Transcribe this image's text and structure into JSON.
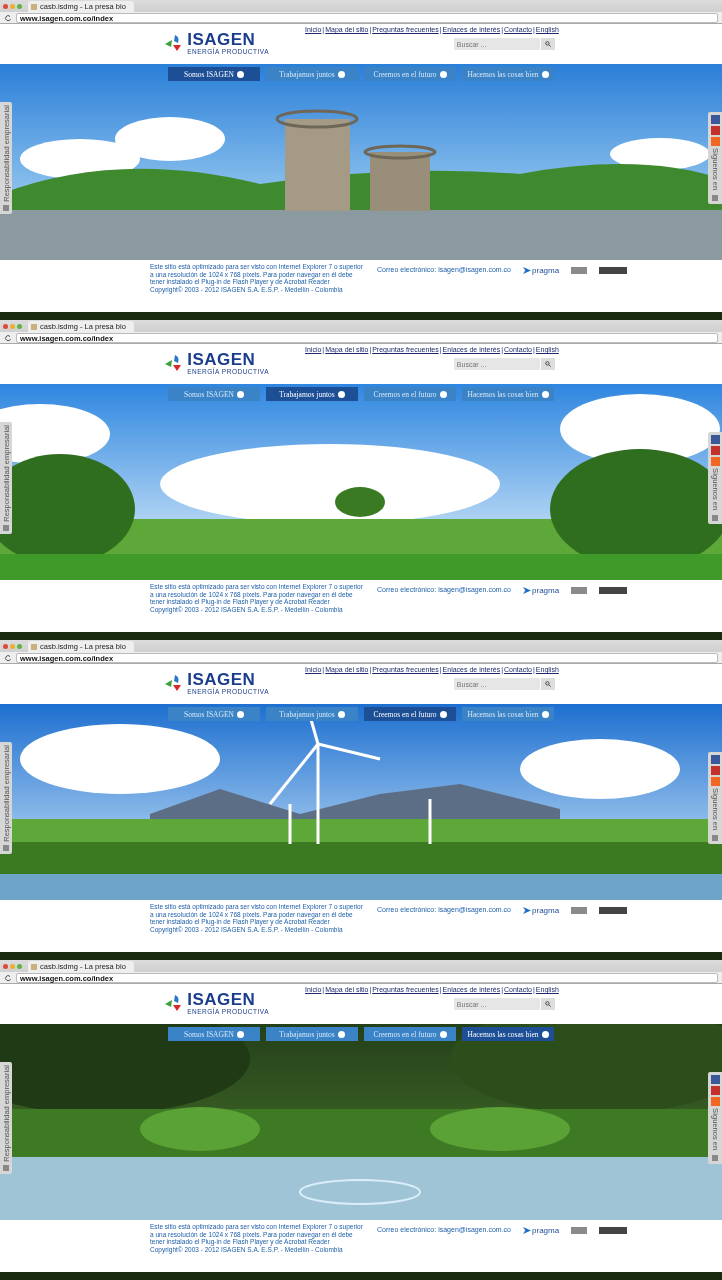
{
  "screens": [
    {
      "kind": "dam",
      "tab_title": "casb.isdmg - La presa bio",
      "url": "www.isagen.com.co/index",
      "logo": {
        "name": "ISAGEN",
        "tagline": "ENERGÍA PRODUCTIVA"
      },
      "top_links": [
        {
          "kind": "link",
          "text": "Inicio"
        },
        {
          "kind": "separator",
          "text": "|"
        },
        {
          "kind": "link",
          "text": "Mapa del sitio"
        },
        {
          "kind": "separator",
          "text": "|"
        },
        {
          "kind": "link",
          "text": "Preguntas frecuentes"
        },
        {
          "kind": "separator",
          "text": "|"
        },
        {
          "kind": "link",
          "text": "Enlaces de interés"
        },
        {
          "kind": "separator",
          "text": "|"
        },
        {
          "kind": "link",
          "text": "Contacto"
        },
        {
          "kind": "separator",
          "text": "|"
        },
        {
          "kind": "link",
          "text": "English"
        }
      ],
      "search": {
        "placeholder": "Buscar ..."
      },
      "nav": [
        {
          "label": "Somos ISAGEN",
          "selected": true
        },
        {
          "label": "Trabajamos juntos",
          "selected": false
        },
        {
          "label": "Creemos en el futuro",
          "selected": false
        },
        {
          "label": "Hacemos las cosas bien",
          "selected": false
        }
      ],
      "side_tab": "Responsabilidad empresarial",
      "follow_tab": "Síguenos en",
      "footer": {
        "notice": "Este sitio está optimizado para ser visto con Internet Explorer 7 o superior a una resolución de 1024 x 768 píxels. Para poder navegar en él debe tener instalado el Plug-in de Flash Player y de Acrobat Reader",
        "copyright": "Copyright© 2003 - 2012 ISAGEN S.A. E.S.P. - Medellín - Colombia",
        "email_label": "Correo electrónico:",
        "email": "isagen@isagen.com.co",
        "partner": "pragma"
      }
    },
    {
      "kind": "meadow",
      "tab_title": "casb.isdmg - La presa bio",
      "url": "www.isagen.com.co/index",
      "logo": {
        "name": "ISAGEN",
        "tagline": "ENERGÍA PRODUCTIVA"
      },
      "top_links": [
        {
          "kind": "link",
          "text": "Inicio"
        },
        {
          "kind": "separator",
          "text": "|"
        },
        {
          "kind": "link",
          "text": "Mapa del sitio"
        },
        {
          "kind": "separator",
          "text": "|"
        },
        {
          "kind": "link",
          "text": "Preguntas frecuentes"
        },
        {
          "kind": "separator",
          "text": "|"
        },
        {
          "kind": "link",
          "text": "Enlaces de interés"
        },
        {
          "kind": "separator",
          "text": "|"
        },
        {
          "kind": "link",
          "text": "Contacto"
        },
        {
          "kind": "separator",
          "text": "|"
        },
        {
          "kind": "link",
          "text": "English"
        }
      ],
      "search": {
        "placeholder": "Buscar ..."
      },
      "nav": [
        {
          "label": "Somos ISAGEN",
          "selected": false
        },
        {
          "label": "Trabajamos juntos",
          "selected": true
        },
        {
          "label": "Creemos en el futuro",
          "selected": false
        },
        {
          "label": "Hacemos las cosas bien",
          "selected": false
        }
      ],
      "side_tab": "Responsabilidad empresarial",
      "follow_tab": "Síguenos en",
      "footer": {
        "notice": "Este sitio está optimizado para ser visto con Internet Explorer 7 o superior a una resolución de 1024 x 768 píxels. Para poder navegar en él debe tener instalado el Plug-in de Flash Player y de Acrobat Reader",
        "copyright": "Copyright© 2003 - 2012 ISAGEN S.A. E.S.P. - Medellín - Colombia",
        "email_label": "Correo electrónico:",
        "email": "isagen@isagen.com.co",
        "partner": "pragma"
      }
    },
    {
      "kind": "wind",
      "tab_title": "casb.isdmg - La presa bio",
      "url": "www.isagen.com.co/index",
      "logo": {
        "name": "ISAGEN",
        "tagline": "ENERGÍA PRODUCTIVA"
      },
      "top_links": [
        {
          "kind": "link",
          "text": "Inicio"
        },
        {
          "kind": "separator",
          "text": "|"
        },
        {
          "kind": "link",
          "text": "Mapa del sitio"
        },
        {
          "kind": "separator",
          "text": "|"
        },
        {
          "kind": "link",
          "text": "Preguntas frecuentes"
        },
        {
          "kind": "separator",
          "text": "|"
        },
        {
          "kind": "link",
          "text": "Enlaces de interés"
        },
        {
          "kind": "separator",
          "text": "|"
        },
        {
          "kind": "link",
          "text": "Contacto"
        },
        {
          "kind": "separator",
          "text": "|"
        },
        {
          "kind": "link",
          "text": "English"
        }
      ],
      "search": {
        "placeholder": "Buscar ..."
      },
      "nav": [
        {
          "label": "Somos ISAGEN",
          "selected": false
        },
        {
          "label": "Trabajamos juntos",
          "selected": false
        },
        {
          "label": "Creemos en el futuro",
          "selected": true
        },
        {
          "label": "Hacemos las cosas bien",
          "selected": false
        }
      ],
      "side_tab": "Responsabilidad empresarial",
      "follow_tab": "Síguenos en",
      "footer": {
        "notice": "Este sitio está optimizado para ser visto con Internet Explorer 7 o superior a una resolución de 1024 x 768 píxels. Para poder navegar en él debe tener instalado el Plug-in de Flash Player y de Acrobat Reader",
        "copyright": "Copyright© 2003 - 2012 ISAGEN S.A. E.S.P. - Medellín - Colombia",
        "email_label": "Correo electrónico:",
        "email": "isagen@isagen.com.co",
        "partner": "pragma"
      }
    },
    {
      "kind": "forest",
      "tab_title": "casb.isdmg - La presa bio",
      "url": "www.isagen.com.co/index",
      "logo": {
        "name": "ISAGEN",
        "tagline": "ENERGÍA PRODUCTIVA"
      },
      "top_links": [
        {
          "kind": "link",
          "text": "Inicio"
        },
        {
          "kind": "separator",
          "text": "|"
        },
        {
          "kind": "link",
          "text": "Mapa del sitio"
        },
        {
          "kind": "separator",
          "text": "|"
        },
        {
          "kind": "link",
          "text": "Preguntas frecuentes"
        },
        {
          "kind": "separator",
          "text": "|"
        },
        {
          "kind": "link",
          "text": "Enlaces de interés"
        },
        {
          "kind": "separator",
          "text": "|"
        },
        {
          "kind": "link",
          "text": "Contacto"
        },
        {
          "kind": "separator",
          "text": "|"
        },
        {
          "kind": "link",
          "text": "English"
        }
      ],
      "search": {
        "placeholder": "Buscar ..."
      },
      "nav": [
        {
          "label": "Somos ISAGEN",
          "selected": false
        },
        {
          "label": "Trabajamos juntos",
          "selected": false
        },
        {
          "label": "Creemos en el futuro",
          "selected": false
        },
        {
          "label": "Hacemos las cosas bien",
          "selected": true
        }
      ],
      "side_tab": "Responsabilidad empresarial",
      "follow_tab": "Síguenos en",
      "footer": {
        "notice": "Este sitio está optimizado para ser visto con Internet Explorer 7 o superior a una resolución de 1024 x 768 píxels. Para poder navegar en él debe tener instalado el Plug-in de Flash Player y de Acrobat Reader",
        "copyright": "Copyright© 2003 - 2012 ISAGEN S.A. E.S.P. - Medellín - Colombia",
        "email_label": "Correo electrónico:",
        "email": "isagen@isagen.com.co",
        "partner": "pragma"
      }
    }
  ]
}
